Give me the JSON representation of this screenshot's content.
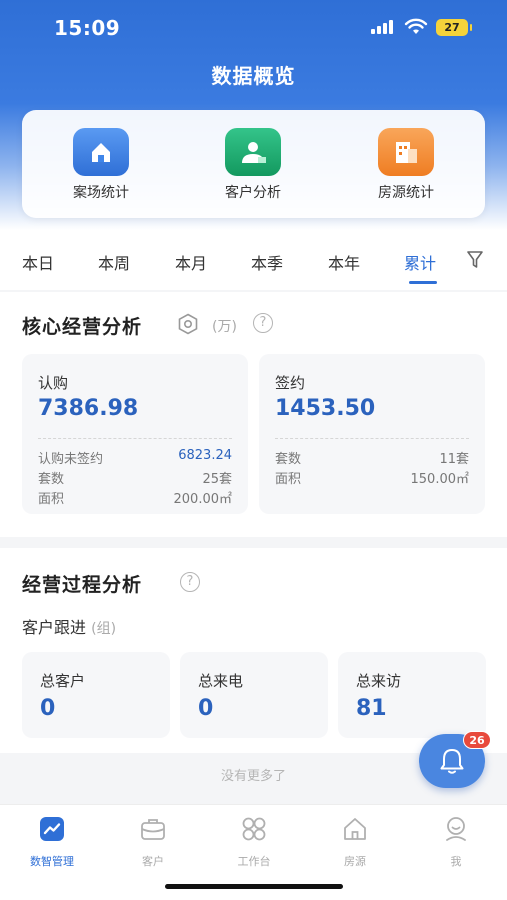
{
  "status_bar": {
    "time": "15:09",
    "battery": "27"
  },
  "page_title": "数据概览",
  "quick_actions": [
    {
      "label": "案场统计",
      "icon": "house-icon",
      "color": "#3f86ea"
    },
    {
      "label": "客户分析",
      "icon": "person-icon",
      "color": "#1fb27a"
    },
    {
      "label": "房源统计",
      "icon": "building-icon",
      "color": "#f5913a"
    }
  ],
  "period_tabs": [
    "本日",
    "本周",
    "本月",
    "本季",
    "本年",
    "累计"
  ],
  "active_tab": "累计",
  "core": {
    "title": "核心经营分析",
    "unit": "(万)",
    "help": "?",
    "subscribe": {
      "label": "认购",
      "value": "7386.98",
      "rows": [
        {
          "label": "认购未签约",
          "value": "6823.24"
        },
        {
          "label": "套数",
          "value": "25套"
        },
        {
          "label": "面积",
          "value": "200.00㎡"
        }
      ]
    },
    "contract": {
      "label": "签约",
      "value": "1453.50",
      "rows": [
        {
          "label": "套数",
          "value": "11套"
        },
        {
          "label": "面积",
          "value": "150.00㎡"
        }
      ]
    }
  },
  "process": {
    "title": "经营过程分析",
    "help": "?",
    "followup_label": "客户跟进",
    "followup_unit": "(组)",
    "stats": [
      {
        "label": "总客户",
        "value": "0"
      },
      {
        "label": "总来电",
        "value": "0"
      },
      {
        "label": "总来访",
        "value": "81"
      }
    ]
  },
  "no_more": "没有更多了",
  "notification_count": "26",
  "tabbar": [
    {
      "label": "数智管理",
      "icon": "chart-icon",
      "active": true
    },
    {
      "label": "客户",
      "icon": "briefcase-icon",
      "active": false
    },
    {
      "label": "工作台",
      "icon": "grid-icon",
      "active": false
    },
    {
      "label": "房源",
      "icon": "house-icon",
      "active": false
    },
    {
      "label": "我",
      "icon": "user-icon",
      "active": false
    }
  ]
}
